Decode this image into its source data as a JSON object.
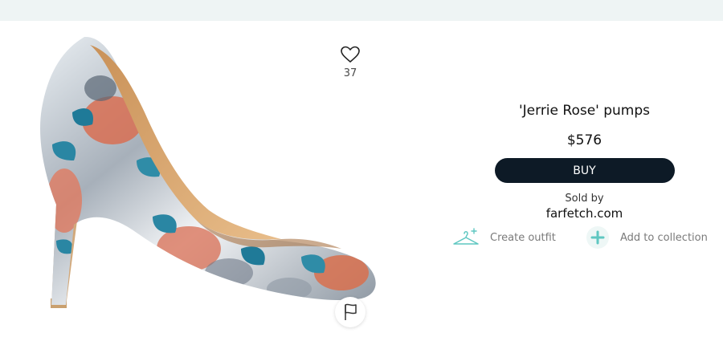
{
  "favorites": {
    "count": "37"
  },
  "product": {
    "title": "'Jerrie Rose' pumps",
    "price": "$576",
    "buy_label": "BUY",
    "sold_by_label": "Sold by",
    "seller": "farfetch.com"
  },
  "actions": {
    "create_outfit_label": "Create outfit",
    "add_to_collection_label": "Add to collection"
  },
  "icons": {
    "favorite": "heart-icon",
    "report": "flag-icon",
    "outfit": "hanger-icon",
    "collection": "plus-icon"
  },
  "colors": {
    "buy_button": "#0d1a26",
    "accent_teal": "#5fc7c1",
    "top_bar": "#eef4f4"
  }
}
